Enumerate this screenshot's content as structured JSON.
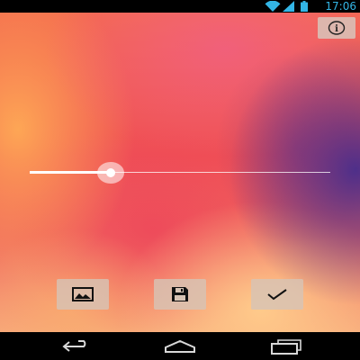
{
  "status_bar": {
    "time": "17:06",
    "icons": [
      "wifi-icon",
      "cell-signal-icon",
      "battery-icon"
    ],
    "accent_color": "#33b5e5"
  },
  "info_button": {
    "icon": "info-icon",
    "glyph": "i"
  },
  "slider": {
    "value": 0.27
  },
  "actions": [
    {
      "name": "image-button",
      "icon": "image-icon"
    },
    {
      "name": "save-button",
      "icon": "floppy-disk-icon"
    },
    {
      "name": "confirm-button",
      "icon": "checkmark-icon"
    }
  ],
  "nav_bar": {
    "icons": [
      "back-icon",
      "home-icon",
      "recent-apps-icon"
    ]
  }
}
